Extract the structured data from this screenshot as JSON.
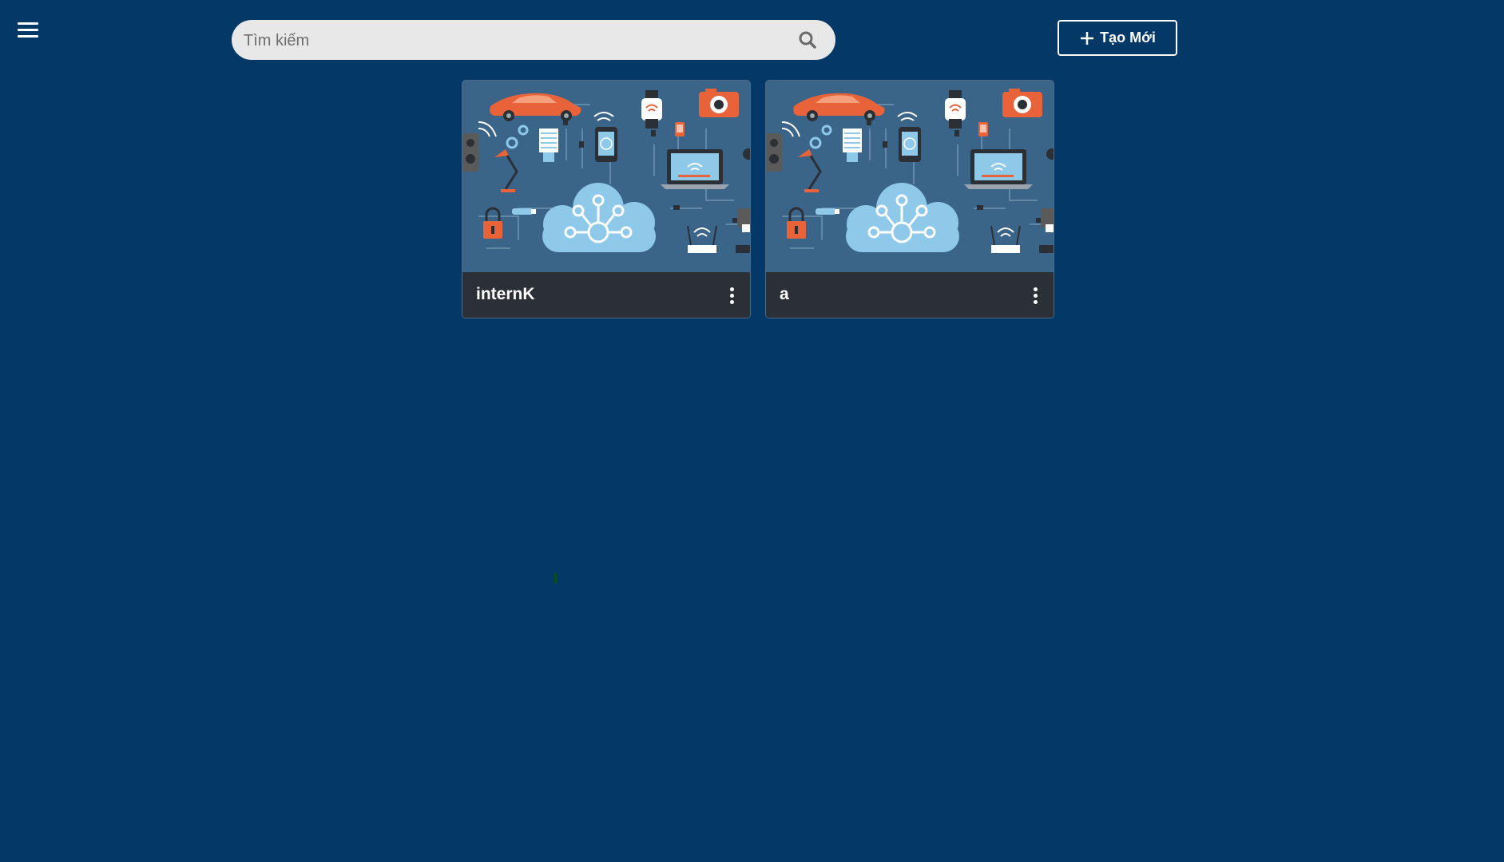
{
  "header": {
    "search": {
      "placeholder": "Tìm kiếm",
      "value": ""
    },
    "create_button_label": "Tạo Mới"
  },
  "cards": [
    {
      "title": "internK"
    },
    {
      "title": "a"
    }
  ],
  "colors": {
    "background": "#033867",
    "card_footer": "#2b2f36",
    "search_bg": "#e8e8e8",
    "accent_orange": "#e8633a",
    "cloud_blue": "#8ec9ea"
  },
  "icons": {
    "menu": "hamburger-menu-icon",
    "search": "search-icon",
    "create": "plus-icon",
    "card_menu": "more-vertical-icon"
  }
}
